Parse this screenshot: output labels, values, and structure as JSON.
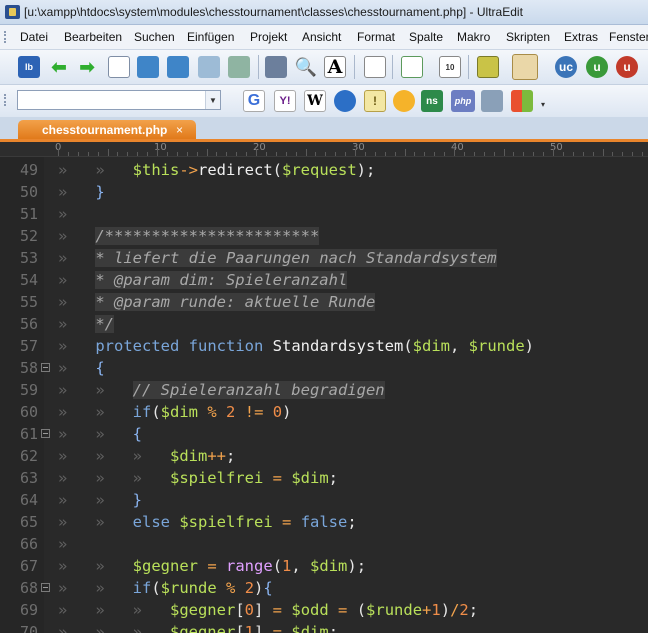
{
  "window": {
    "title": "[u:\\xampp\\htdocs\\system\\modules\\chesstournament\\classes\\chesstournament.php] - UltraEdit"
  },
  "menu": [
    "Datei",
    "Bearbeiten",
    "Suchen",
    "Einfügen",
    "Projekt",
    "Ansicht",
    "Format",
    "Spalte",
    "Makro",
    "Skripten",
    "Extras",
    "Fenster"
  ],
  "toolbar1": {
    "icons": [
      "page-setup-icon",
      "back-arrow-icon",
      "forward-arrow-icon",
      "new-file-icon",
      "open-folder-icon",
      "open-folder-2-icon",
      "save-icon",
      "save-all-icon",
      "print-icon",
      "print-preview-icon",
      "font-icon",
      "word-wrap-icon",
      "list-icon",
      "hex-edit-icon",
      "column-mode-icon",
      "active-view-icon",
      "uc-icon",
      "up-icon",
      "us-icon"
    ]
  },
  "toolbar2": {
    "search_value": "",
    "icons": [
      "google-icon",
      "yahoo-icon",
      "wikipedia-icon",
      "dictionary-icon",
      "info-icon",
      "sun-icon",
      "ns-icon",
      "php-icon",
      "database-icon",
      "windows-icon"
    ],
    "labels": {
      "google": "G",
      "yahoo": "Y!",
      "wikipedia": "W",
      "php": "php"
    }
  },
  "tabs": [
    {
      "label": "chesstournament.php",
      "close": "×"
    }
  ],
  "ruler": {
    "labels": [
      "0",
      "10",
      "20",
      "30",
      "40",
      "50"
    ]
  },
  "editor": {
    "lines": [
      {
        "n": "49",
        "fold": false,
        "text": "    $this->redirect($request);"
      },
      {
        "n": "50",
        "fold": false,
        "text": "}"
      },
      {
        "n": "51",
        "fold": false,
        "text": ""
      },
      {
        "n": "52",
        "fold": false,
        "text": "/***********************"
      },
      {
        "n": "53",
        "fold": false,
        "text": " * liefert die Paarungen nach Standardsystem"
      },
      {
        "n": "54",
        "fold": false,
        "text": " * @param dim: Spieleranzahl"
      },
      {
        "n": "55",
        "fold": false,
        "text": " * @param runde: aktuelle Runde"
      },
      {
        "n": "56",
        "fold": false,
        "text": " */"
      },
      {
        "n": "57",
        "fold": false,
        "text": "protected function Standardsystem($dim, $runde)"
      },
      {
        "n": "58",
        "fold": true,
        "text": "{"
      },
      {
        "n": "59",
        "fold": false,
        "text": "    // Spieleranzahl begradigen"
      },
      {
        "n": "60",
        "fold": false,
        "text": "    if($dim % 2 != 0)"
      },
      {
        "n": "61",
        "fold": true,
        "text": "    {"
      },
      {
        "n": "62",
        "fold": false,
        "text": "        $dim++;"
      },
      {
        "n": "63",
        "fold": false,
        "text": "        $spielfrei = $dim;"
      },
      {
        "n": "64",
        "fold": false,
        "text": "    }"
      },
      {
        "n": "65",
        "fold": false,
        "text": "    else $spielfrei = false;"
      },
      {
        "n": "66",
        "fold": false,
        "text": ""
      },
      {
        "n": "67",
        "fold": false,
        "text": "    $gegner = range(1, $dim);"
      },
      {
        "n": "68",
        "fold": true,
        "text": "    if($runde % 2){"
      },
      {
        "n": "69",
        "fold": false,
        "text": "        $gegner[0] = $odd = ($runde+1)/2;"
      },
      {
        "n": "70",
        "fold": false,
        "text": "        $gegner[1] = $dim;"
      }
    ]
  }
}
